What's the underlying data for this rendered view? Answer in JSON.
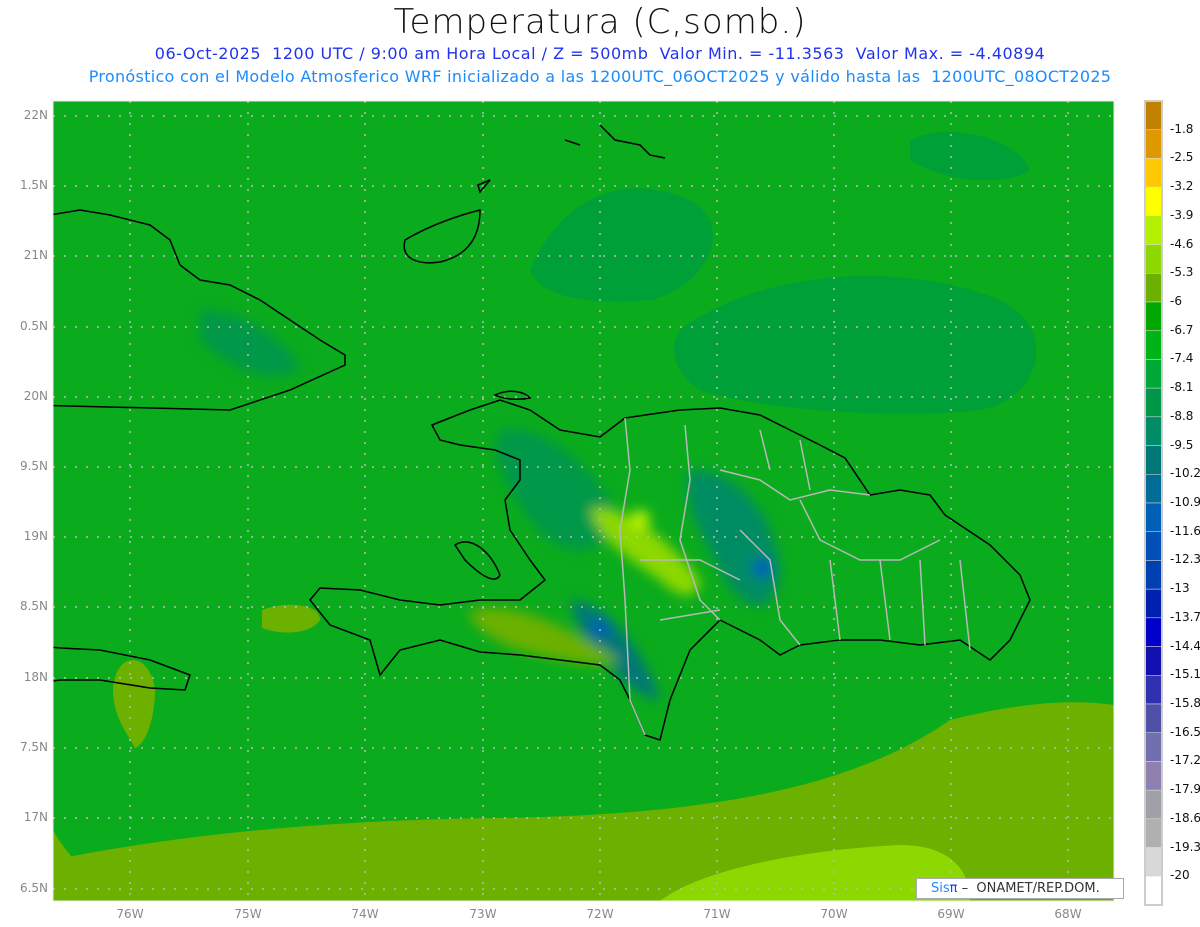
{
  "header": {
    "title": "Temperatura (C,somb.)",
    "line1": "06-Oct-2025  1200 UTC / 9:00 am Hora Local / Z = 500mb  Valor Min. = -11.3563  Valor Max. = -4.40894",
    "line2": "Pronóstico con el Modelo Atmosferico WRF inicializado a las 1200UTC_06OCT2025 y válido hasta las  1200UTC_08OCT2025"
  },
  "map": {
    "lat_labels": [
      "22N",
      "1.5N",
      "21N",
      "0.5N",
      "20N",
      "9.5N",
      "19N",
      "8.5N",
      "18N",
      "7.5N",
      "17N",
      "6.5N"
    ],
    "lon_labels": [
      "76W",
      "75W",
      "74W",
      "73W",
      "72W",
      "71W",
      "70W",
      "69W",
      "68W"
    ],
    "background_color": "#0aab1c"
  },
  "colorbar": {
    "labels": [
      "-1.8",
      "-2.5",
      "-3.2",
      "-3.9",
      "-4.6",
      "-5.3",
      "-6",
      "-6.7",
      "-7.4",
      "-8.1",
      "-8.8",
      "-9.5",
      "-10.2",
      "-10.9",
      "-11.6",
      "-12.3",
      "-13",
      "-13.7",
      "-14.4",
      "-15.1",
      "-15.8",
      "-16.5",
      "-17.2",
      "-17.9",
      "-18.6",
      "-19.3",
      "-20"
    ],
    "colors": [
      "#c08000",
      "#e09800",
      "#ffc800",
      "#ffff00",
      "#b4f000",
      "#8cd800",
      "#6cb000",
      "#00a800",
      "#00b418",
      "#00a838",
      "#009848",
      "#008c64",
      "#007878",
      "#006c98",
      "#0060b8",
      "#0050b8",
      "#0040b0",
      "#0020b0",
      "#0000c8",
      "#1010b0",
      "#3030b0",
      "#5050a8",
      "#7070b0",
      "#9080b0",
      "#a0a0a8",
      "#b0b0b0",
      "#d8d8d8",
      "#ffffff"
    ]
  },
  "credit": {
    "sis": "Sis",
    "pi": "π",
    "rest": " –  ONAMET/REP.DOM."
  }
}
